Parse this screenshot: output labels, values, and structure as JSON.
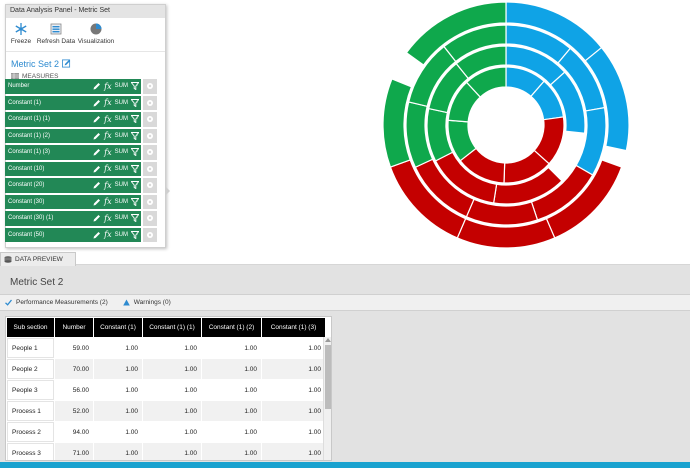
{
  "panel": {
    "title": "Data Analysis Panel - Metric Set",
    "toolbar": [
      {
        "label": "Freeze",
        "icon": "snowflake-icon"
      },
      {
        "label": "Refresh Data",
        "icon": "refresh-icon"
      },
      {
        "label": "Visualization",
        "icon": "pie-chart-icon"
      }
    ],
    "metric_set_name": "Metric Set 2",
    "measures_header": "MEASURES",
    "measures": [
      {
        "label": "Number",
        "aggregate": "SUM"
      },
      {
        "label": "Constant (1)",
        "aggregate": "SUM"
      },
      {
        "label": "Constant (1) (1)",
        "aggregate": "SUM"
      },
      {
        "label": "Constant (1) (2)",
        "aggregate": "SUM"
      },
      {
        "label": "Constant (1) (3)",
        "aggregate": "SUM"
      },
      {
        "label": "Constant (10)",
        "aggregate": "SUM"
      },
      {
        "label": "Constant (20)",
        "aggregate": "SUM"
      },
      {
        "label": "Constant (30)",
        "aggregate": "SUM"
      },
      {
        "label": "Constant (30) (1)",
        "aggregate": "SUM"
      },
      {
        "label": "Constant (50)",
        "aggregate": "SUM"
      }
    ],
    "fx_symbol": "fx",
    "colors": {
      "measure_bg": "#228856",
      "accent": "#2e8bd0"
    }
  },
  "chart_data": {
    "type": "sunburst",
    "rings": [
      {
        "ring": 1,
        "segments": [
          {
            "color": "#0fa3e6",
            "start_deg": 0,
            "end_deg": 82
          },
          {
            "color": "#c40000",
            "start_deg": 82,
            "end_deg": 232
          },
          {
            "color": "#0fa84c",
            "start_deg": 232,
            "end_deg": 360
          }
        ]
      },
      {
        "ring": 2,
        "segments": [
          {
            "color": "#0fa3e6",
            "start_deg": 0,
            "end_deg": 96
          },
          {
            "color": "#c40000",
            "start_deg": 135,
            "end_deg": 243
          },
          {
            "color": "#0fa84c",
            "start_deg": 243,
            "end_deg": 360
          }
        ]
      },
      {
        "ring": 3,
        "segments": [
          {
            "color": "#0fa3e6",
            "start_deg": 0,
            "end_deg": 120
          },
          {
            "color": "#c40000",
            "start_deg": 120,
            "end_deg": 245
          },
          {
            "color": "#0fa84c",
            "start_deg": 245,
            "end_deg": 360
          }
        ]
      },
      {
        "ring": 4,
        "segments": [
          {
            "color": "#0fa3e6",
            "start_deg": 0,
            "end_deg": 102
          },
          {
            "color": "#c40000",
            "start_deg": 110,
            "end_deg": 250
          },
          {
            "color": "#0fa84c",
            "start_deg": 250,
            "end_deg": 292
          },
          {
            "color": "#0fa84c",
            "start_deg": 306,
            "end_deg": 360
          }
        ]
      }
    ],
    "colors": {
      "blue": "#0fa3e6",
      "red": "#c40000",
      "green": "#0fa84c"
    }
  },
  "preview": {
    "tab_label": "DATA PREVIEW",
    "title": "Metric Set 2",
    "subtabs": [
      {
        "label": "Performance Measurements (2)",
        "icon": "check-icon"
      },
      {
        "label": "Warnings (0)",
        "icon": "warning-icon"
      }
    ],
    "columns": [
      "Sub section",
      "Number",
      "Constant (1)",
      "Constant (1) (1)",
      "Constant (1) (2)",
      "Constant (1) (3)"
    ],
    "rows": [
      [
        "People 1",
        "59.00",
        "1.00",
        "1.00",
        "1.00",
        "1.00"
      ],
      [
        "People 2",
        "70.00",
        "1.00",
        "1.00",
        "1.00",
        "1.00"
      ],
      [
        "People 3",
        "56.00",
        "1.00",
        "1.00",
        "1.00",
        "1.00"
      ],
      [
        "Process 1",
        "52.00",
        "1.00",
        "1.00",
        "1.00",
        "1.00"
      ],
      [
        "Process 2",
        "94.00",
        "1.00",
        "1.00",
        "1.00",
        "1.00"
      ],
      [
        "Process 3",
        "71.00",
        "1.00",
        "1.00",
        "1.00",
        "1.00"
      ]
    ]
  }
}
